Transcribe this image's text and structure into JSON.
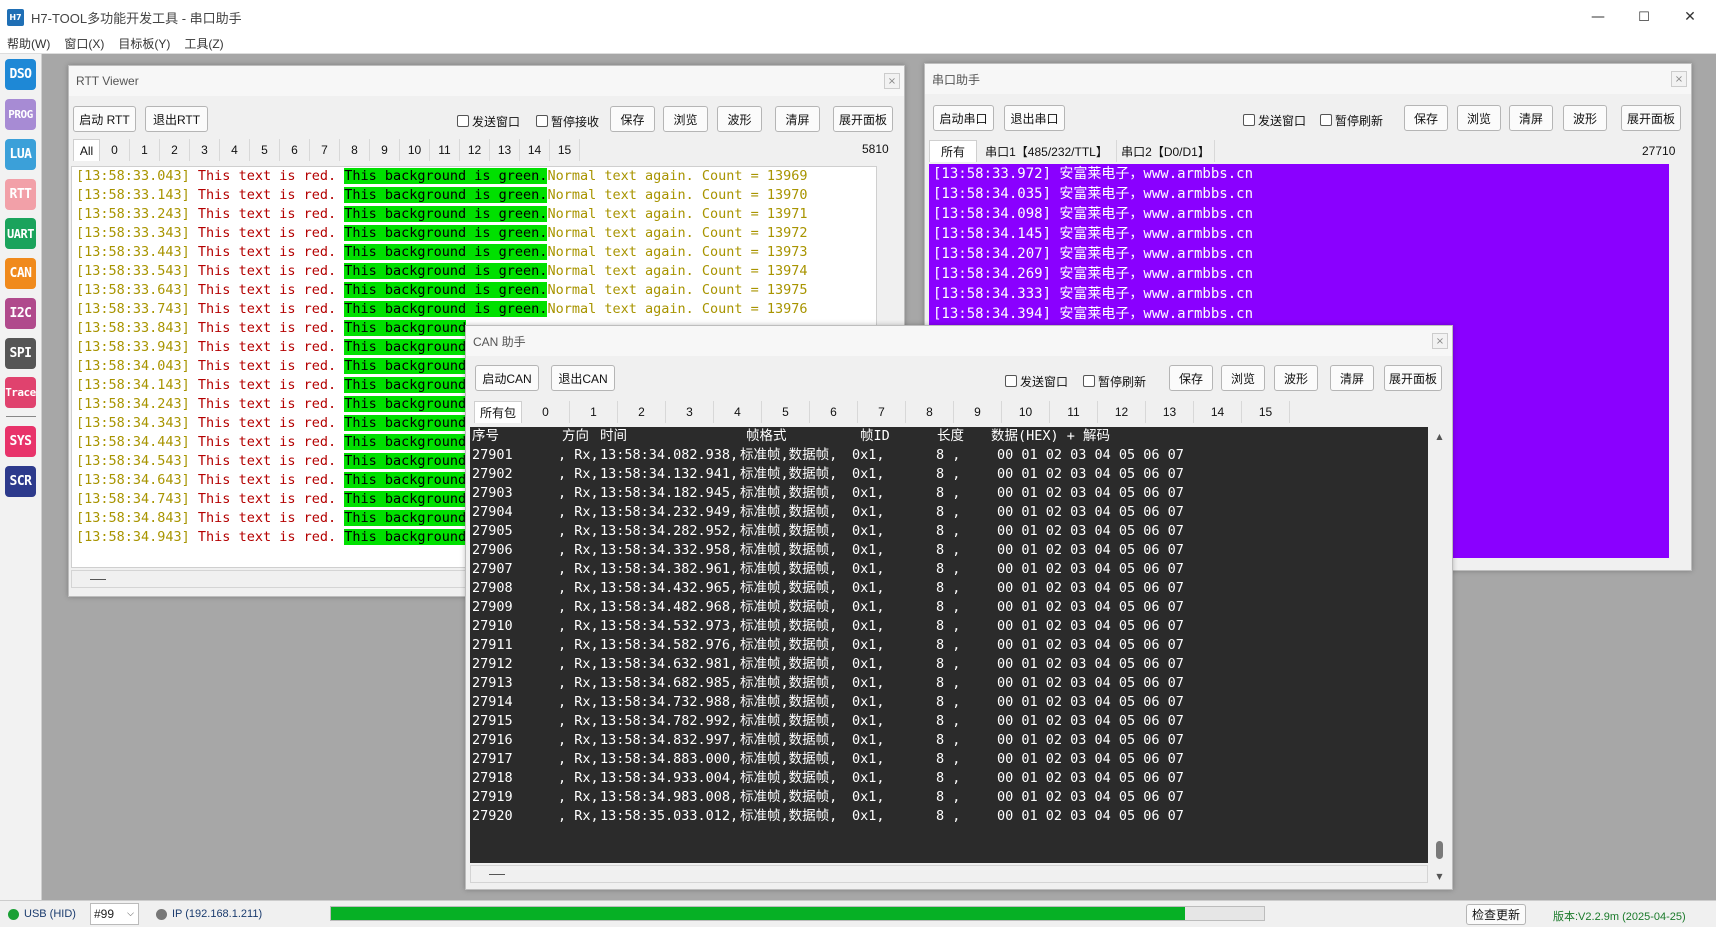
{
  "app": {
    "icon_text": "H7",
    "title": "H7-TOOL多功能开发工具 - 串口助手",
    "controls": [
      "—",
      "☐",
      "✕"
    ]
  },
  "menu": [
    "帮助(W)",
    "窗口(X)",
    "目标板(Y)",
    "工具(Z)"
  ],
  "sidebar": [
    {
      "label": "DSO",
      "color": "#1e88d6"
    },
    {
      "label": "PROG",
      "color": "#a78bd4"
    },
    {
      "label": "LUA",
      "color": "#3ba0d9"
    },
    {
      "label": "RTT",
      "color": "#f2a0a8"
    },
    {
      "label": "UART",
      "color": "#1aa35c"
    },
    {
      "label": "CAN",
      "color": "#f08a1c"
    },
    {
      "label": "I2C",
      "color": "#b04a8c"
    },
    {
      "label": "SPI",
      "color": "#555555"
    },
    {
      "label": "Trace",
      "color": "#e0426e"
    },
    {
      "label": "SYS",
      "color": "#e8336a"
    },
    {
      "label": "SCR",
      "color": "#2d3a8c"
    }
  ],
  "rtt": {
    "title": "RTT Viewer",
    "close": "×",
    "btn_start": "启动 RTT",
    "btn_exit": "退出RTT",
    "chk_send": "发送窗口",
    "chk_pause": "暂停接收",
    "btn_save": "保存",
    "btn_browse": "浏览",
    "btn_wave": "波形",
    "btn_clear": "清屏",
    "btn_expand": "展开面板",
    "tabs": [
      "All",
      "0",
      "1",
      "2",
      "3",
      "4",
      "5",
      "6",
      "7",
      "8",
      "9",
      "10",
      "11",
      "12",
      "13",
      "14",
      "15"
    ],
    "count": "5810",
    "lines": [
      {
        "ts": "[13:58:33.043]",
        "red": " This text is red. ",
        "green": "This background is green.",
        "yellow": "Normal text again. Count = 13969"
      },
      {
        "ts": "[13:58:33.143]",
        "red": " This text is red. ",
        "green": "This background is green.",
        "yellow": "Normal text again. Count = 13970"
      },
      {
        "ts": "[13:58:33.243]",
        "red": " This text is red. ",
        "green": "This background is green.",
        "yellow": "Normal text again. Count = 13971"
      },
      {
        "ts": "[13:58:33.343]",
        "red": " This text is red. ",
        "green": "This background is green.",
        "yellow": "Normal text again. Count = 13972"
      },
      {
        "ts": "[13:58:33.443]",
        "red": " This text is red. ",
        "green": "This background is green.",
        "yellow": "Normal text again. Count = 13973"
      },
      {
        "ts": "[13:58:33.543]",
        "red": " This text is red. ",
        "green": "This background is green.",
        "yellow": "Normal text again. Count = 13974"
      },
      {
        "ts": "[13:58:33.643]",
        "red": " This text is red. ",
        "green": "This background is green.",
        "yellow": "Normal text again. Count = 13975"
      },
      {
        "ts": "[13:58:33.743]",
        "red": " This text is red. ",
        "green": "This background is green.",
        "yellow": "Normal text again. Count = 13976"
      },
      {
        "ts": "[13:58:33.843]",
        "red": " This text is red. ",
        "green": "This background",
        "yellow": ""
      },
      {
        "ts": "[13:58:33.943]",
        "red": " This text is red. ",
        "green": "This background",
        "yellow": ""
      },
      {
        "ts": "[13:58:34.043]",
        "red": " This text is red. ",
        "green": "This background",
        "yellow": ""
      },
      {
        "ts": "[13:58:34.143]",
        "red": " This text is red. ",
        "green": "This background",
        "yellow": ""
      },
      {
        "ts": "[13:58:34.243]",
        "red": " This text is red. ",
        "green": "This background",
        "yellow": ""
      },
      {
        "ts": "[13:58:34.343]",
        "red": " This text is red. ",
        "green": "This background",
        "yellow": ""
      },
      {
        "ts": "[13:58:34.443]",
        "red": " This text is red. ",
        "green": "This background",
        "yellow": ""
      },
      {
        "ts": "[13:58:34.543]",
        "red": " This text is red. ",
        "green": "This background",
        "yellow": ""
      },
      {
        "ts": "[13:58:34.643]",
        "red": " This text is red. ",
        "green": "This background",
        "yellow": ""
      },
      {
        "ts": "[13:58:34.743]",
        "red": " This text is red. ",
        "green": "This background",
        "yellow": ""
      },
      {
        "ts": "[13:58:34.843]",
        "red": " This text is red. ",
        "green": "This background",
        "yellow": ""
      },
      {
        "ts": "[13:58:34.943]",
        "red": " This text is red. ",
        "green": "This background",
        "yellow": ""
      }
    ]
  },
  "uart": {
    "title": "串口助手",
    "close": "×",
    "btn_start": "启动串口",
    "btn_exit": "退出串口",
    "chk_send": "发送窗口",
    "chk_pause": "暂停刷新",
    "btn_save": "保存",
    "btn_browse": "浏览",
    "btn_clear": "清屏",
    "btn_wave": "波形",
    "btn_expand": "展开面板",
    "tabs": [
      "所有",
      "串口1【485/232/TTL】",
      "串口2【D0/D1】"
    ],
    "count": "27710",
    "lines": [
      "[13:58:33.972] 安富莱电子，www.armbbs.cn",
      "[13:58:34.035] 安富莱电子，www.armbbs.cn",
      "[13:58:34.098] 安富莱电子，www.armbbs.cn",
      "[13:58:34.145] 安富莱电子，www.armbbs.cn",
      "[13:58:34.207] 安富莱电子，www.armbbs.cn",
      "[13:58:34.269] 安富莱电子，www.armbbs.cn",
      "[13:58:34.333] 安富莱电子，www.armbbs.cn",
      "[13:58:34.394] 安富莱电子，www.armbbs.cn"
    ]
  },
  "can": {
    "title": "CAN 助手",
    "close": "×",
    "btn_start": "启动CAN",
    "btn_exit": "退出CAN",
    "chk_send": "发送窗口",
    "chk_pause": "暂停刷新",
    "btn_save": "保存",
    "btn_browse": "浏览",
    "btn_wave": "波形",
    "btn_clear": "清屏",
    "btn_expand": "展开面板",
    "tabs": [
      "所有包",
      "0",
      "1",
      "2",
      "3",
      "4",
      "5",
      "6",
      "7",
      "8",
      "9",
      "10",
      "11",
      "12",
      "13",
      "14",
      "15"
    ],
    "header": {
      "seq": "序号",
      "dir": "方向",
      "time": "时间",
      "fmt": "帧格式",
      "id": "帧ID",
      "len": "长度",
      "data": "数据(HEX) + 解码"
    },
    "rows": [
      {
        "seq": "27901",
        "dir": ", Rx,",
        "time": "13:58:34.082.938,",
        "fmt": "标准帧,数据帧,",
        "id": "0x1,",
        "len": "8 ,",
        "data": "00 01 02 03 04 05 06 07"
      },
      {
        "seq": "27902",
        "dir": ", Rx,",
        "time": "13:58:34.132.941,",
        "fmt": "标准帧,数据帧,",
        "id": "0x1,",
        "len": "8 ,",
        "data": "00 01 02 03 04 05 06 07"
      },
      {
        "seq": "27903",
        "dir": ", Rx,",
        "time": "13:58:34.182.945,",
        "fmt": "标准帧,数据帧,",
        "id": "0x1,",
        "len": "8 ,",
        "data": "00 01 02 03 04 05 06 07"
      },
      {
        "seq": "27904",
        "dir": ", Rx,",
        "time": "13:58:34.232.949,",
        "fmt": "标准帧,数据帧,",
        "id": "0x1,",
        "len": "8 ,",
        "data": "00 01 02 03 04 05 06 07"
      },
      {
        "seq": "27905",
        "dir": ", Rx,",
        "time": "13:58:34.282.952,",
        "fmt": "标准帧,数据帧,",
        "id": "0x1,",
        "len": "8 ,",
        "data": "00 01 02 03 04 05 06 07"
      },
      {
        "seq": "27906",
        "dir": ", Rx,",
        "time": "13:58:34.332.958,",
        "fmt": "标准帧,数据帧,",
        "id": "0x1,",
        "len": "8 ,",
        "data": "00 01 02 03 04 05 06 07"
      },
      {
        "seq": "27907",
        "dir": ", Rx,",
        "time": "13:58:34.382.961,",
        "fmt": "标准帧,数据帧,",
        "id": "0x1,",
        "len": "8 ,",
        "data": "00 01 02 03 04 05 06 07"
      },
      {
        "seq": "27908",
        "dir": ", Rx,",
        "time": "13:58:34.432.965,",
        "fmt": "标准帧,数据帧,",
        "id": "0x1,",
        "len": "8 ,",
        "data": "00 01 02 03 04 05 06 07"
      },
      {
        "seq": "27909",
        "dir": ", Rx,",
        "time": "13:58:34.482.968,",
        "fmt": "标准帧,数据帧,",
        "id": "0x1,",
        "len": "8 ,",
        "data": "00 01 02 03 04 05 06 07"
      },
      {
        "seq": "27910",
        "dir": ", Rx,",
        "time": "13:58:34.532.973,",
        "fmt": "标准帧,数据帧,",
        "id": "0x1,",
        "len": "8 ,",
        "data": "00 01 02 03 04 05 06 07"
      },
      {
        "seq": "27911",
        "dir": ", Rx,",
        "time": "13:58:34.582.976,",
        "fmt": "标准帧,数据帧,",
        "id": "0x1,",
        "len": "8 ,",
        "data": "00 01 02 03 04 05 06 07"
      },
      {
        "seq": "27912",
        "dir": ", Rx,",
        "time": "13:58:34.632.981,",
        "fmt": "标准帧,数据帧,",
        "id": "0x1,",
        "len": "8 ,",
        "data": "00 01 02 03 04 05 06 07"
      },
      {
        "seq": "27913",
        "dir": ", Rx,",
        "time": "13:58:34.682.985,",
        "fmt": "标准帧,数据帧,",
        "id": "0x1,",
        "len": "8 ,",
        "data": "00 01 02 03 04 05 06 07"
      },
      {
        "seq": "27914",
        "dir": ", Rx,",
        "time": "13:58:34.732.988,",
        "fmt": "标准帧,数据帧,",
        "id": "0x1,",
        "len": "8 ,",
        "data": "00 01 02 03 04 05 06 07"
      },
      {
        "seq": "27915",
        "dir": ", Rx,",
        "time": "13:58:34.782.992,",
        "fmt": "标准帧,数据帧,",
        "id": "0x1,",
        "len": "8 ,",
        "data": "00 01 02 03 04 05 06 07"
      },
      {
        "seq": "27916",
        "dir": ", Rx,",
        "time": "13:58:34.832.997,",
        "fmt": "标准帧,数据帧,",
        "id": "0x1,",
        "len": "8 ,",
        "data": "00 01 02 03 04 05 06 07"
      },
      {
        "seq": "27917",
        "dir": ", Rx,",
        "time": "13:58:34.883.000,",
        "fmt": "标准帧,数据帧,",
        "id": "0x1,",
        "len": "8 ,",
        "data": "00 01 02 03 04 05 06 07"
      },
      {
        "seq": "27918",
        "dir": ", Rx,",
        "time": "13:58:34.933.004,",
        "fmt": "标准帧,数据帧,",
        "id": "0x1,",
        "len": "8 ,",
        "data": "00 01 02 03 04 05 06 07"
      },
      {
        "seq": "27919",
        "dir": ", Rx,",
        "time": "13:58:34.983.008,",
        "fmt": "标准帧,数据帧,",
        "id": "0x1,",
        "len": "8 ,",
        "data": "00 01 02 03 04 05 06 07"
      },
      {
        "seq": "27920",
        "dir": ", Rx,",
        "time": "13:58:35.033.012,",
        "fmt": "标准帧,数据帧,",
        "id": "0x1,",
        "len": "8 ,",
        "data": "00 01 02 03 04 05 06 07"
      }
    ]
  },
  "status": {
    "usb": "USB (HID)",
    "usb_color": "#1aa035",
    "device": "#99",
    "ip": "IP (192.168.1.211)",
    "ip_color": "#777777",
    "progress": 0.915,
    "progress_color": "#06b025",
    "check_update": "检查更新",
    "version": "版本:V2.2.9m (2025-04-25)"
  }
}
